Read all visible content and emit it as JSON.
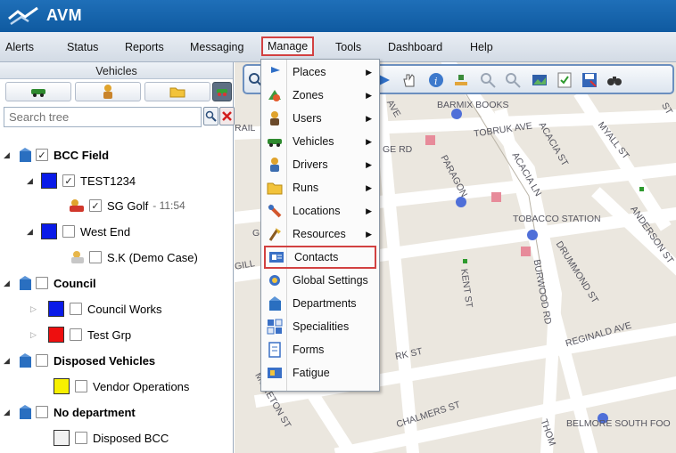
{
  "app": {
    "title": "AVM"
  },
  "menubar": {
    "items": [
      "Alerts",
      "Status",
      "Reports",
      "Messaging",
      "Manage",
      "Tools",
      "Dashboard",
      "Help"
    ],
    "active": "Manage"
  },
  "sidebar": {
    "header": "Vehicles",
    "search_placeholder": "Search tree",
    "tree": [
      {
        "label": "BCC Field",
        "bold": true,
        "checked": true
      },
      {
        "label": "TEST1234",
        "checked": true,
        "color": "#0a1be8"
      },
      {
        "label": "SG Golf",
        "time": "- 11:54",
        "checked": true
      },
      {
        "label": "West End",
        "checked": false,
        "color": "#0a1be8"
      },
      {
        "label": "S.K (Demo Case)",
        "checked": false
      },
      {
        "label": "Council",
        "bold": true,
        "checked": false
      },
      {
        "label": "Council Works",
        "checked": false,
        "color": "#0a1be8"
      },
      {
        "label": "Test Grp",
        "checked": false,
        "color": "#ee0f0f"
      },
      {
        "label": "Disposed Vehicles",
        "bold": true,
        "checked": false
      },
      {
        "label": "Vendor Operations",
        "checked": false,
        "color": "#f7f000"
      },
      {
        "label": "No department",
        "bold": true,
        "checked": false
      },
      {
        "label": "Disposed BCC",
        "checked": false,
        "color": "#f2f2f2"
      }
    ]
  },
  "manage_menu": {
    "items": [
      {
        "label": "Places",
        "submenu": true,
        "icon": "pin-icon"
      },
      {
        "label": "Zones",
        "submenu": true,
        "icon": "zones-icon"
      },
      {
        "label": "Users",
        "submenu": true,
        "icon": "user-icon"
      },
      {
        "label": "Vehicles",
        "submenu": true,
        "icon": "car-icon"
      },
      {
        "label": "Drivers",
        "submenu": true,
        "icon": "driver-icon"
      },
      {
        "label": "Runs",
        "submenu": true,
        "icon": "folder-icon"
      },
      {
        "label": "Locations",
        "submenu": true,
        "icon": "locations-icon"
      },
      {
        "label": "Resources",
        "submenu": true,
        "icon": "resources-icon"
      },
      {
        "label": "Contacts",
        "submenu": false,
        "icon": "contacts-icon",
        "highlighted": true
      },
      {
        "label": "Global Settings",
        "submenu": false,
        "icon": "settings-icon"
      },
      {
        "label": "Departments",
        "submenu": false,
        "icon": "building-icon"
      },
      {
        "label": "Specialities",
        "submenu": false,
        "icon": "specialities-icon"
      },
      {
        "label": "Forms",
        "submenu": false,
        "icon": "forms-icon"
      },
      {
        "label": "Fatigue",
        "submenu": false,
        "icon": "fatigue-icon"
      }
    ]
  },
  "map": {
    "labels": {
      "barmix": "BARMIX BOOKS",
      "tobruk": "TOBRUK AVE",
      "myall": "MYALL ST",
      "paragon": "PARAGON",
      "acacia_st": "ACACIA ST",
      "acacia_ln": "ACACIA LN",
      "tobacco": "TOBACCO STATION",
      "anderson": "ANDERSON ST",
      "drummond": "DRUMMOND ST",
      "burwood": "BURWOOD RD",
      "kent": "KENT ST",
      "reginald": "REGINALD AVE",
      "rk": "RK ST",
      "moreton": "MORETON ST",
      "chalmers": "CHALMERS ST",
      "belmore": "BELMORE SOUTH FOO",
      "thom": "THOM",
      "rail": "RAIL",
      "gill": "GILL",
      "ge_rd": "GE RD",
      "ave": "AVE",
      "g": "G",
      "st_right": "ST"
    }
  }
}
